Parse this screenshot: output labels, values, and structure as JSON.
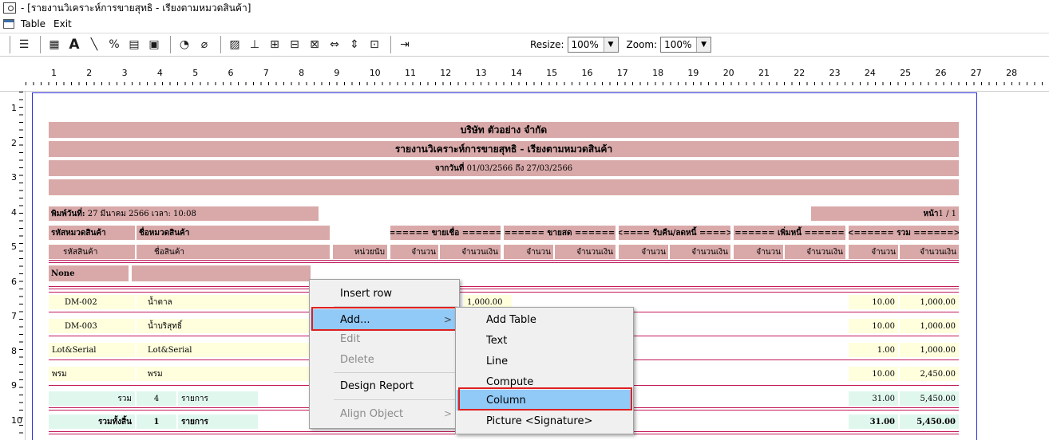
{
  "window": {
    "title": " - [รายงานวิเคราะห์การขายสุทธิ - เรียงตามหมวดสินค้า]"
  },
  "menu": {
    "items": [
      "Table",
      "Exit"
    ]
  },
  "toolbar": {
    "resize_label": "Resize:",
    "resize_value": "100%",
    "zoom_label": "Zoom:",
    "zoom_value": "100%"
  },
  "ruler": {
    "top_numbers": [
      "1",
      "2",
      "3",
      "4",
      "5",
      "6",
      "7",
      "8",
      "9",
      "10",
      "11",
      "12",
      "13",
      "14",
      "15",
      "16",
      "17",
      "18",
      "19",
      "20",
      "21",
      "22",
      "23",
      "24",
      "25",
      "26",
      "27",
      "28"
    ],
    "left_numbers": [
      "1",
      "2",
      "3",
      "4",
      "5",
      "6",
      "7",
      "8",
      "9",
      "10"
    ]
  },
  "report": {
    "company": "บริษัท ตัวอย่าง จำกัด",
    "title": "รายงานวิเคราะห์การขายสุทธิ - เรียงตามหมวดสินค้า",
    "date_prefix": "จากวันที่",
    "date_range": "01/03/2566 ถึง 27/03/2566",
    "printed_prefix": "พิมพ์วันที่:",
    "printed_value": "27 มีนาคม 2566 เวลา: 10:08",
    "page_prefix": "หน้า",
    "page_value": "1 / 1",
    "header1": {
      "category_code": "รหัสหมวดสินค้า",
      "category_name": "ชื่อหมวดสินค้า",
      "group_credit": "<====== ขายเชื่อ ======>",
      "group_cash": "<====== ขายสด ======>",
      "group_return": "<==== รับคืน/ลดหนี้ ====>",
      "group_debit": "<====== เพิ่มหนี้ ======>",
      "group_total": "<====== รวม ======>"
    },
    "header2": {
      "product_code": "รหัสสินค้า",
      "product_name": "ชื่อสินค้า",
      "unit": "หน่วยนับ",
      "qty": "จำนวน",
      "amount": "จำนวนเงิน"
    },
    "group_none": "None",
    "rows": [
      {
        "code": "DM-002",
        "name": "น้ำตาล",
        "col_mid": "1,000.00",
        "qty": "10.00",
        "amount": "1,000.00"
      },
      {
        "code": "DM-003",
        "name": "น้ำบริสุทธิ์",
        "qty": "10.00",
        "amount": "1,000.00"
      },
      {
        "code": "Lot&Serial",
        "name": "Lot&Serial",
        "qty": "1.00",
        "amount": "1,000.00"
      },
      {
        "code": "พรม",
        "name": "พรม",
        "qty": "10.00",
        "amount": "2,450.00"
      }
    ],
    "subtotal": {
      "label": "รวม",
      "count": "4",
      "unit": "รายการ",
      "qty": "31.00",
      "amount": "5,450.00"
    },
    "grandtotal": {
      "label": "รวมทั้งสิ้น",
      "count": "1",
      "unit": "รายการ",
      "qty": "31.00",
      "amount": "5,450.00"
    }
  },
  "context_menu": {
    "items": [
      "Insert row",
      "Add...",
      "Edit",
      "Delete",
      "Design Report",
      "Align Object"
    ],
    "submenu_arrow": ">"
  },
  "submenu": {
    "items": [
      "Add Table",
      "Text",
      "Line",
      "Compute",
      "Column",
      "Picture <Signature>"
    ]
  },
  "colors": {
    "band": "#d9a9a9",
    "row_yellow": "#ffffdd",
    "row_green": "#e0f7ee",
    "highlight": "#e02020",
    "selected": "#91c9f7",
    "page_border": "#2b2bd8"
  }
}
